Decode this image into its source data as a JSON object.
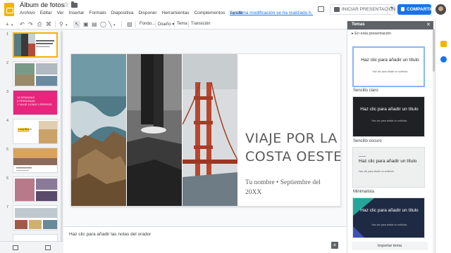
{
  "header": {
    "doc_title": "Álbum de fotos",
    "menu": [
      "Archivo",
      "Editar",
      "Ver",
      "Insertar",
      "Formato",
      "Diapositiva",
      "Disponer",
      "Herramientas",
      "Complementos",
      "Ayuda"
    ],
    "last_edit": "La última modificación se ha realizado h...",
    "present_label": "INICIAR PRESENTACIÓN",
    "share_label": "COMPARTIR"
  },
  "toolbar": {
    "fondo": "Fondo...",
    "diseno": "Diseño ▾",
    "tema": "Tema",
    "transicion": "Transición"
  },
  "filmstrip": {
    "numbers": [
      "1",
      "2",
      "3",
      "4",
      "5",
      "6",
      "7"
    ],
    "slide3_lines": [
      "18 SEMANAS",
      "8 PERSONAS",
      "1 VIAJE",
      "5 DÍAS",
      "3 PERROS"
    ],
    "slide4_label": "Long Beach"
  },
  "slide": {
    "title_line1": "VIAJE POR LA",
    "title_line2": "COSTA OESTE",
    "subtitle_line1": "Tu nombre • Septiembre del",
    "subtitle_line2": "20XX"
  },
  "notes": {
    "placeholder": "Haz clic para añadir las notas del orador"
  },
  "themes_panel": {
    "header": "Temas",
    "section": "En esta presentación",
    "card_title": "Haz clic para añadir un título",
    "card_subtitle": "Haz clic para añadir un subtítulo",
    "themes": [
      {
        "name": "Sencillo claro"
      },
      {
        "name": "Sencillo oscuro"
      },
      {
        "name": "Minimalista"
      },
      {
        "name": ""
      }
    ],
    "import_label": "Importar tema"
  },
  "colors": {
    "accent": "#1a73e8",
    "brand": "#f4b400",
    "panel_header": "#5f6368"
  }
}
